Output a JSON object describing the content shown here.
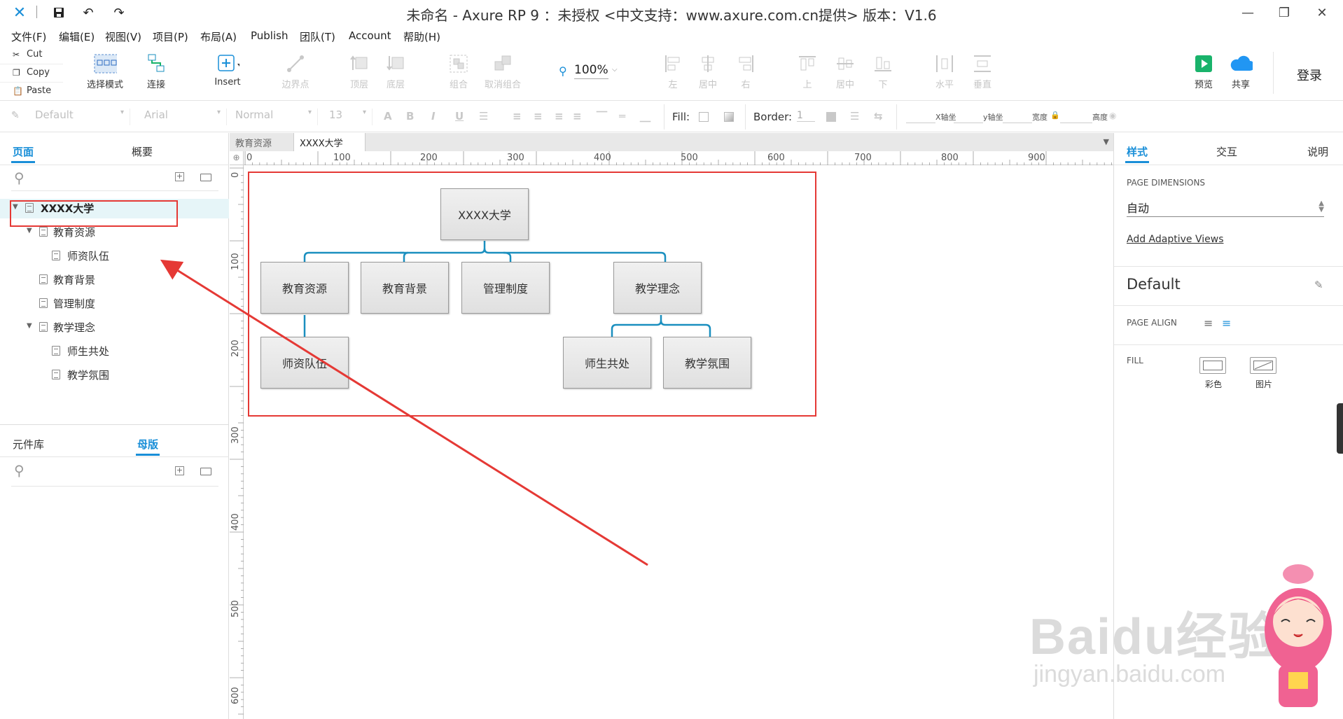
{
  "window": {
    "title": "未命名 - Axure RP 9 ：未授权    <中文支持：www.axure.com.cn提供> 版本：V1.6"
  },
  "menu": [
    "文件(F)",
    "编辑(E)",
    "视图(V)",
    "项目(P)",
    "布局(A)",
    "Publish",
    "团队(T)",
    "Account",
    "帮助(H)"
  ],
  "clipboard": {
    "cut": "Cut",
    "copy": "Copy",
    "paste": "Paste"
  },
  "toolbar": {
    "select_mode": "选择模式",
    "connect": "连接",
    "insert": "Insert",
    "points": "边界点",
    "top": "顶层",
    "bottom": "底层",
    "group": "组合",
    "ungroup": "取消组合",
    "zoom": "100%",
    "align_left": "左",
    "align_center": "居中",
    "align_right": "右",
    "align_top": "上",
    "align_middle": "居中",
    "align_bottom": "下",
    "dist_h": "水平",
    "dist_v": "垂直",
    "preview": "预览",
    "share": "共享",
    "login": "登录",
    "preview_color": "#19b36b",
    "share_color": "#2196f3"
  },
  "format": {
    "style": "Default",
    "font": "Arial",
    "weight": "Normal",
    "size": "13",
    "fill_label": "Fill:",
    "border_label": "Border:",
    "border_value": "1",
    "x_label": "X轴坐",
    "y_label": "y轴坐",
    "w_label": "宽度",
    "h_label": "高度"
  },
  "left": {
    "tab_pages": "页面",
    "tab_outline": "概要",
    "pages": [
      {
        "label": "XXXX大学",
        "level": 0,
        "expanded": true,
        "selected": true
      },
      {
        "label": "教育资源",
        "level": 1,
        "expanded": true
      },
      {
        "label": "师资队伍",
        "level": 2
      },
      {
        "label": "教育背景",
        "level": 1
      },
      {
        "label": "管理制度",
        "level": 1
      },
      {
        "label": "教学理念",
        "level": 1,
        "expanded": true
      },
      {
        "label": "师生共处",
        "level": 2
      },
      {
        "label": "教学氛围",
        "level": 2
      }
    ],
    "tab_library": "元件库",
    "tab_masters": "母版",
    "accent": "#1a8fd8",
    "highlight_color": "#e53935"
  },
  "doc_tabs": [
    {
      "label": "教育资源",
      "active": false
    },
    {
      "label": "XXXX大学",
      "active": true
    }
  ],
  "ruler": {
    "h": [
      "0",
      "100",
      "200",
      "300",
      "400",
      "500",
      "600",
      "700",
      "800",
      "900"
    ],
    "v": [
      "0",
      "100",
      "200",
      "300",
      "400",
      "500",
      "600"
    ]
  },
  "diagram": {
    "root": "XXXX大学",
    "level1": [
      "教育资源",
      "教育背景",
      "管理制度",
      "教学理念"
    ],
    "child_of_jyzy": "师资队伍",
    "children_of_jxln": [
      "师生共处",
      "教学氛围"
    ],
    "connector_color": "#1a8fbf"
  },
  "right": {
    "tab_style": "样式",
    "tab_interact": "交互",
    "tab_notes": "说明",
    "page_dimensions_label": "PAGE DIMENSIONS",
    "page_dimensions_value": "自动",
    "adaptive_link": "Add Adaptive Views",
    "style_name": "Default",
    "page_align_label": "PAGE ALIGN",
    "fill_label": "FILL",
    "fill_color": "彩色",
    "fill_image": "图片"
  },
  "watermark": {
    "brand": "Baidu经验",
    "url": "jingyan.baidu.com"
  }
}
